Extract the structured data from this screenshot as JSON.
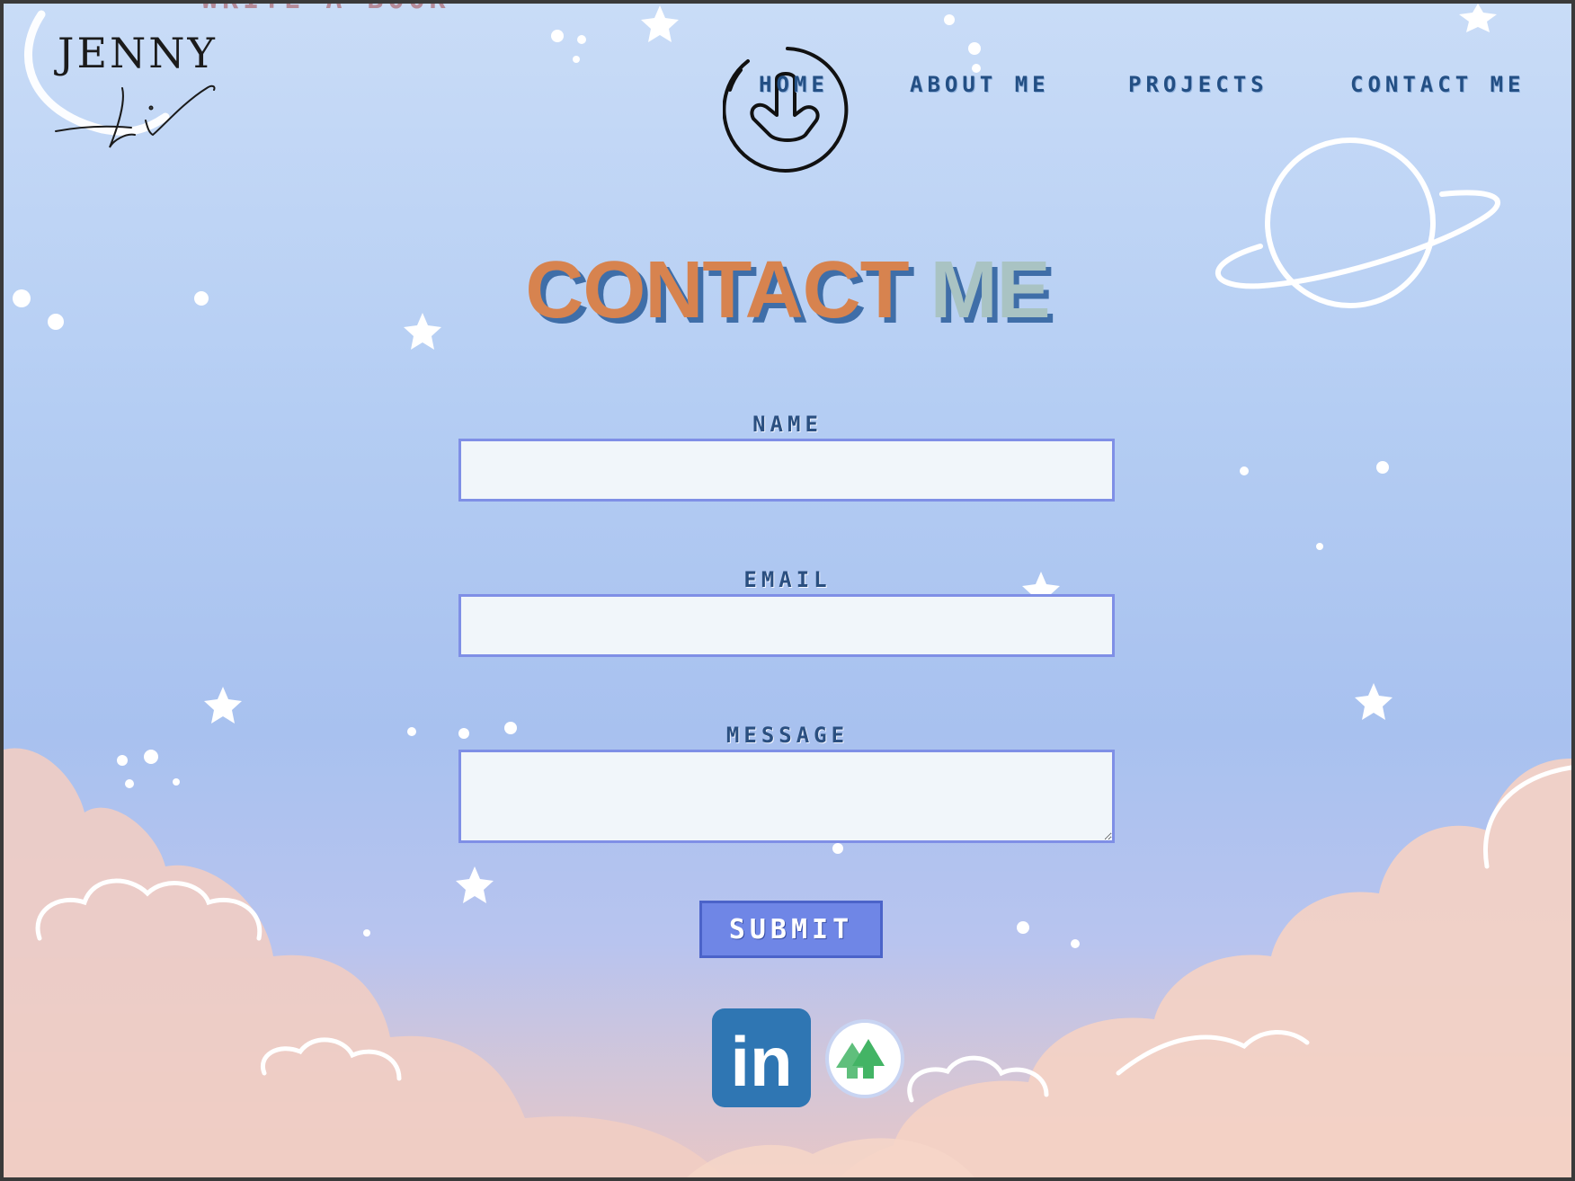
{
  "header": {
    "clipped_text": "WRITE A BOOK",
    "logo_text": "JENNY",
    "nav": {
      "home": "HOME",
      "about": "ABOUT ME",
      "projects": "PROJECTS",
      "contact": "CONTACT ME"
    }
  },
  "main": {
    "title_part1": "CONTACT",
    "title_part2": "ME",
    "form": {
      "name_label": "NAME",
      "email_label": "EMAIL",
      "message_label": "MESSAGE",
      "name_value": "",
      "email_value": "",
      "message_value": "",
      "submit_label": "SUBMIT"
    },
    "social": {
      "linkedin_text": "in"
    }
  },
  "colors": {
    "title_orange": "#d7834f",
    "title_sage": "#a9c3c3",
    "title_shadow": "#3f6ea8",
    "nav_text": "#234f84",
    "field_border": "#7f8fe6",
    "field_fill": "#f1f6fa",
    "button_fill": "#6f86e6",
    "linkedin_blue": "#2f76b3",
    "linktree_green": "#43b465"
  },
  "icons": {
    "scroll": "arrow-down-circle-icon",
    "linkedin": "linkedin-icon",
    "linktree": "linktree-icon"
  }
}
